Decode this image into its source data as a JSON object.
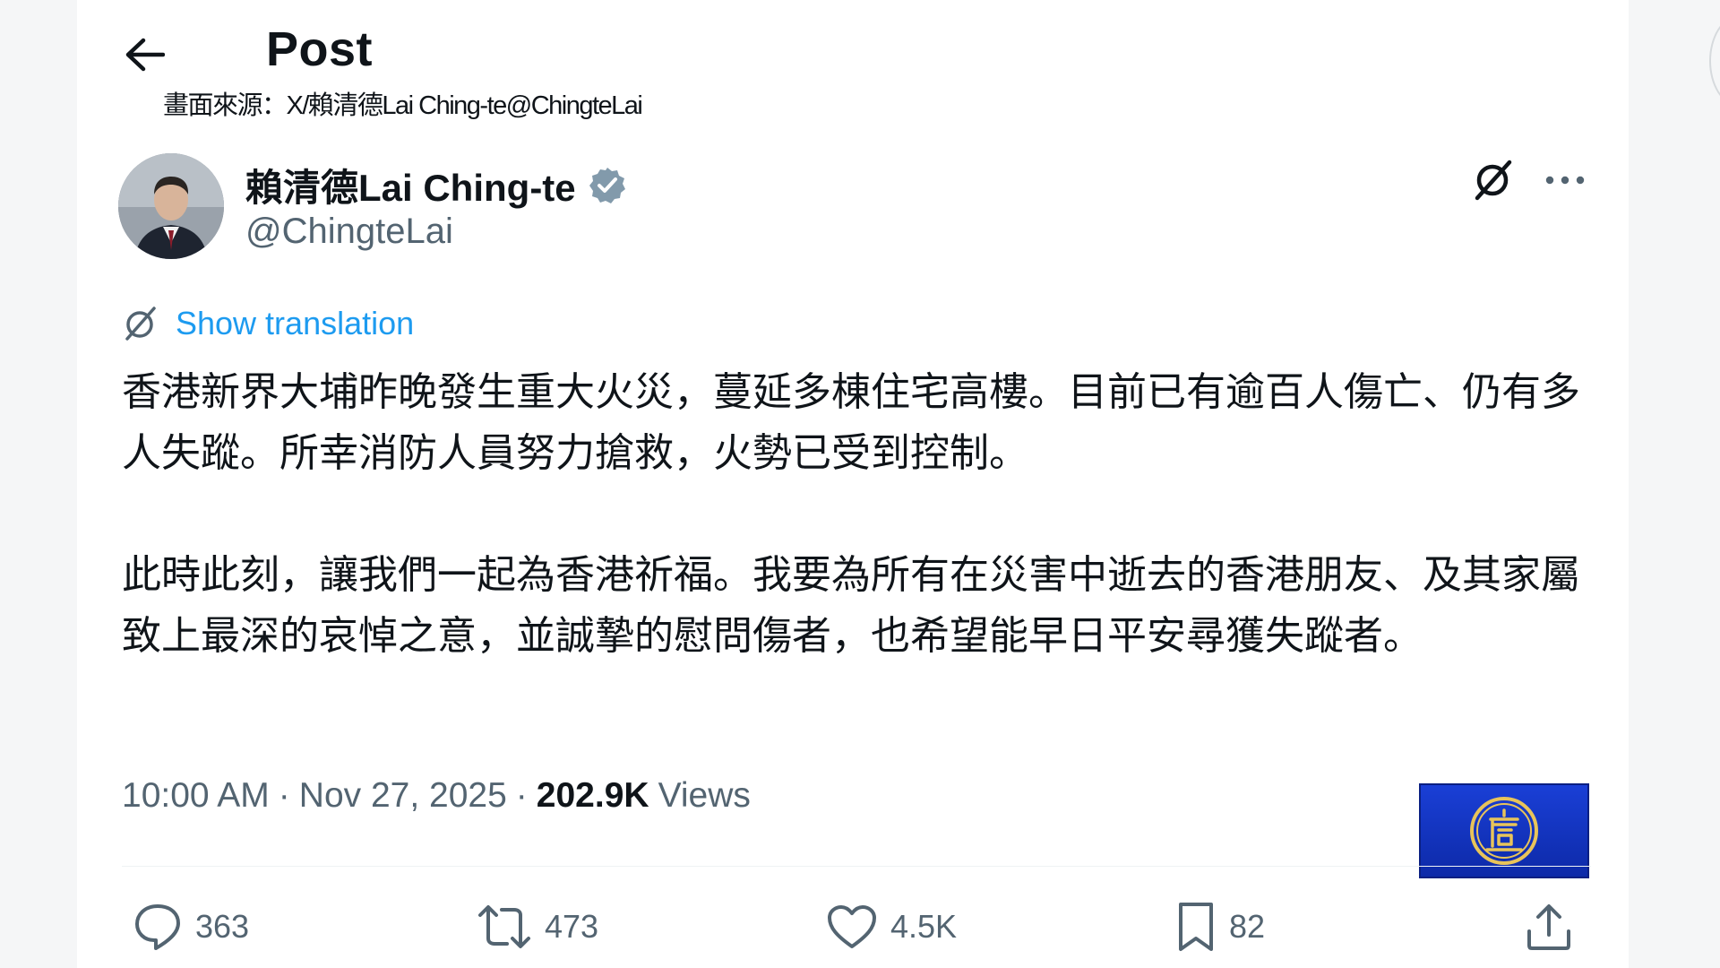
{
  "header": {
    "title": "Post",
    "source_caption": "畫面來源：X/賴清德Lai Ching-te@ChingteLai"
  },
  "author": {
    "name": "賴清德Lai Ching-te",
    "handle": "@ChingteLai",
    "verified": true
  },
  "translate": {
    "label": "Show translation"
  },
  "post": {
    "paragraphs": [
      "香港新界大埔昨晚發生重大火災，蔓延多棟住宅高樓。目前已有逾百人傷亡、仍有多人失蹤。所幸消防人員努力搶救，火勢已受到控制。",
      "此時此刻，讓我們一起為香港祈福。我要為所有在災害中逝去的香港朋友、及其家屬致上最深的哀悼之意，並誠摯的慰問傷者，也希望能早日平安尋獲失蹤者。"
    ]
  },
  "meta": {
    "time": "10:00 AM",
    "date": "Nov 27, 2025",
    "views_count": "202.9K",
    "views_label": "Views"
  },
  "actions": {
    "replies": "363",
    "reposts": "473",
    "likes": "4.5K",
    "bookmarks": "82"
  },
  "colors": {
    "accent": "#1d9bf0",
    "secondary_text": "#536471",
    "primary_text": "#0f1419",
    "logo_blue": "#1a3fd6",
    "logo_gold": "#e8c45a"
  },
  "icons": {
    "back": "arrow-left-icon",
    "verified": "verified-badge-icon",
    "grok": "grok-icon",
    "more": "more-horizontal-icon",
    "translate": "translate-icon",
    "reply": "reply-icon",
    "repost": "repost-icon",
    "like": "heart-icon",
    "bookmark": "bookmark-icon",
    "share": "share-icon",
    "logo": "station-logo-icon"
  }
}
